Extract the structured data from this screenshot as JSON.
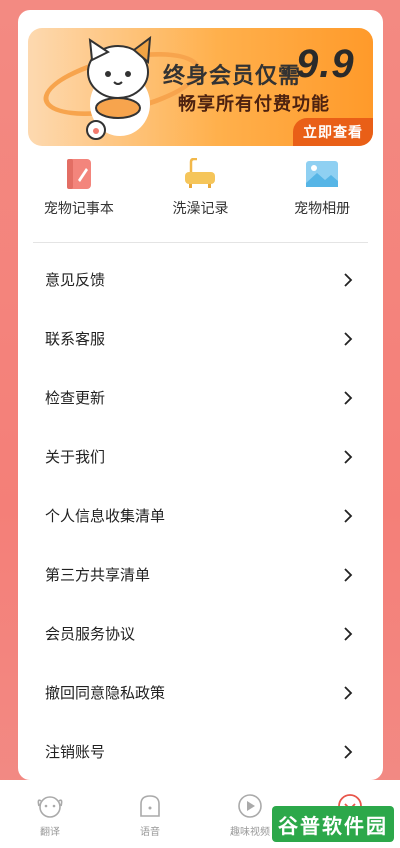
{
  "banner": {
    "title": "终身会员仅需",
    "currency": "¥",
    "price": "9.9",
    "subtitle": "畅享所有付费功能",
    "button": "立即查看"
  },
  "quick_links": [
    {
      "label": "宠物记事本",
      "icon": "notebook-icon"
    },
    {
      "label": "洗澡记录",
      "icon": "bathtub-icon"
    },
    {
      "label": "宠物相册",
      "icon": "photo-album-icon"
    }
  ],
  "menu": [
    {
      "label": "意见反馈"
    },
    {
      "label": "联系客服"
    },
    {
      "label": "检查更新"
    },
    {
      "label": "关于我们"
    },
    {
      "label": "个人信息收集清单"
    },
    {
      "label": "第三方共享清单"
    },
    {
      "label": "会员服务协议"
    },
    {
      "label": "撤回同意隐私政策"
    },
    {
      "label": "注销账号"
    }
  ],
  "tabbar": [
    {
      "label": "翻译",
      "icon": "dog-face-icon"
    },
    {
      "label": "语音",
      "icon": "voice-icon"
    },
    {
      "label": "趣味视频",
      "icon": "play-icon"
    },
    {
      "label": "",
      "icon": "profile-icon"
    }
  ],
  "watermark": "谷普软件园",
  "colors": {
    "accent": "#e95f17",
    "background": "#f38a82",
    "banner": "#ffb04c"
  }
}
